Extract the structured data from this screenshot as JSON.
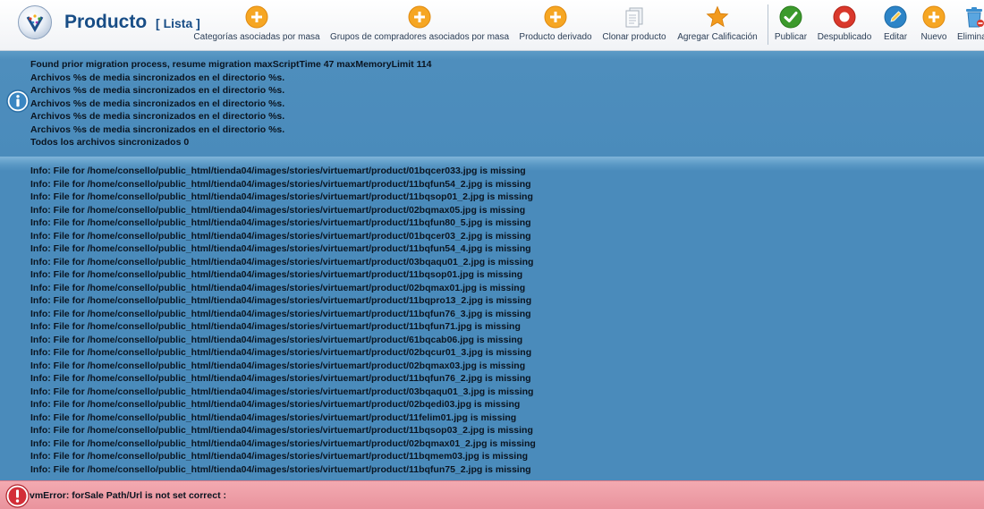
{
  "header": {
    "title": "Producto",
    "subtitle": "[ Lista ]"
  },
  "toolbar": {
    "buttons": [
      {
        "label": "Categorías asociadas por masa",
        "icon": "plus-circle-icon",
        "color": "#f6a623"
      },
      {
        "label": "Grupos de compradores asociados por masa",
        "icon": "plus-circle-icon",
        "color": "#f6a623"
      },
      {
        "label": "Producto derivado",
        "icon": "plus-circle-icon",
        "color": "#f6a623"
      },
      {
        "label": "Clonar producto",
        "icon": "document-copy-icon",
        "color": "#c8ced6"
      },
      {
        "label": "Agregar Calificación",
        "icon": "star-icon",
        "color": "#f29a1e"
      },
      {
        "label": "Publicar",
        "icon": "check-circle-icon",
        "color": "#3c9a2c"
      },
      {
        "label": "Despublicado",
        "icon": "stop-circle-icon",
        "color": "#d9382c"
      },
      {
        "label": "Editar",
        "icon": "pencil-circle-icon",
        "color": "#2d84c7"
      },
      {
        "label": "Nuevo",
        "icon": "plus-circle-icon",
        "color": "#f6a623"
      },
      {
        "label": "Elimina",
        "icon": "trash-icon",
        "color": "#3a8fd0"
      }
    ]
  },
  "messages": {
    "info_block_1": [
      "Found prior migration process, resume migration maxScriptTime 47 maxMemoryLimit 114",
      "Archivos %s de media sincronizados en el directorio %s.",
      "Archivos %s de media sincronizados en el directorio %s.",
      "Archivos %s de media sincronizados en el directorio %s.",
      "Archivos %s de media sincronizados en el directorio %s.",
      "Archivos %s de media sincronizados en el directorio %s.",
      "Todos los archivos sincronizados 0"
    ],
    "info_block_2": [
      "Info: File for /home/consello/public_html/tienda04/images/stories/virtuemart/product/01bqcer033.jpg is missing",
      "Info: File for /home/consello/public_html/tienda04/images/stories/virtuemart/product/11bqfun54_2.jpg is missing",
      "Info: File for /home/consello/public_html/tienda04/images/stories/virtuemart/product/11bqsop01_2.jpg is missing",
      "Info: File for /home/consello/public_html/tienda04/images/stories/virtuemart/product/02bqmax05.jpg is missing",
      "Info: File for /home/consello/public_html/tienda04/images/stories/virtuemart/product/11bqfun80_5.jpg is missing",
      "Info: File for /home/consello/public_html/tienda04/images/stories/virtuemart/product/01bqcer03_2.jpg is missing",
      "Info: File for /home/consello/public_html/tienda04/images/stories/virtuemart/product/11bqfun54_4.jpg is missing",
      "Info: File for /home/consello/public_html/tienda04/images/stories/virtuemart/product/03bqaqu01_2.jpg is missing",
      "Info: File for /home/consello/public_html/tienda04/images/stories/virtuemart/product/11bqsop01.jpg is missing",
      "Info: File for /home/consello/public_html/tienda04/images/stories/virtuemart/product/02bqmax01.jpg is missing",
      "Info: File for /home/consello/public_html/tienda04/images/stories/virtuemart/product/11bqpro13_2.jpg is missing",
      "Info: File for /home/consello/public_html/tienda04/images/stories/virtuemart/product/11bqfun76_3.jpg is missing",
      "Info: File for /home/consello/public_html/tienda04/images/stories/virtuemart/product/11bqfun71.jpg is missing",
      "Info: File for /home/consello/public_html/tienda04/images/stories/virtuemart/product/61bqcab06.jpg is missing",
      "Info: File for /home/consello/public_html/tienda04/images/stories/virtuemart/product/02bqcur01_3.jpg is missing",
      "Info: File for /home/consello/public_html/tienda04/images/stories/virtuemart/product/02bqmax03.jpg is missing",
      "Info: File for /home/consello/public_html/tienda04/images/stories/virtuemart/product/11bqfun76_2.jpg is missing",
      "Info: File for /home/consello/public_html/tienda04/images/stories/virtuemart/product/03bqaqu01_3.jpg is missing",
      "Info: File for /home/consello/public_html/tienda04/images/stories/virtuemart/product/02bqedi03.jpg is missing",
      "Info: File for /home/consello/public_html/tienda04/images/stories/virtuemart/product/11felim01.jpg is missing",
      "Info: File for /home/consello/public_html/tienda04/images/stories/virtuemart/product/11bqsop03_2.jpg is missing",
      "Info: File for /home/consello/public_html/tienda04/images/stories/virtuemart/product/02bqmax01_2.jpg is missing",
      "Info: File for /home/consello/public_html/tienda04/images/stories/virtuemart/product/11bqmem03.jpg is missing",
      "Info: File for /home/consello/public_html/tienda04/images/stories/virtuemart/product/11bqfun75_2.jpg is missing"
    ],
    "error": "vmError: forSale Path/Url is not set correct :"
  },
  "colors": {
    "title": "#184d86",
    "info_panel": "#4a8bbb",
    "error_panel": "#e9939d"
  }
}
